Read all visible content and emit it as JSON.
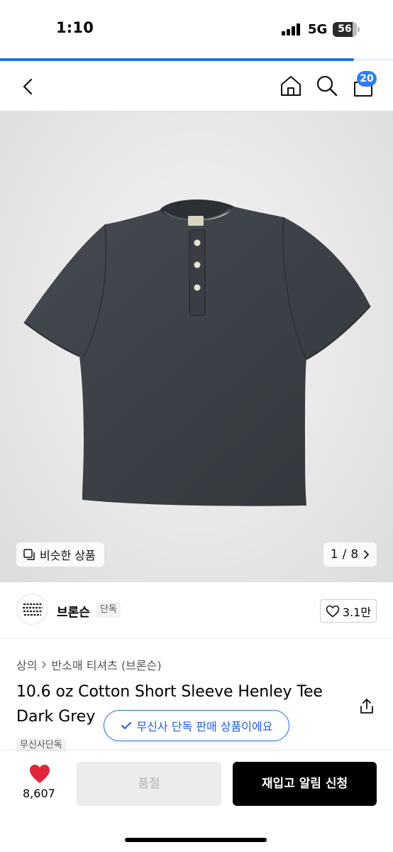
{
  "status_bar": {
    "time": "1:10",
    "network": "5G",
    "battery": "56"
  },
  "page_progress": 0.9,
  "nav": {
    "cart_count": "20"
  },
  "gallery": {
    "similar_label": "비슷한 상품",
    "current": "1",
    "separator": "/",
    "total": "8",
    "next_icon": "chevron-right-icon"
  },
  "brand": {
    "name": "브론슨",
    "tag": "단독",
    "likes": "3.1만",
    "logo_text": "BRONSON MFG. CO."
  },
  "breadcrumb": [
    "상의",
    "반소매 티셔츠 (브론슨)"
  ],
  "product": {
    "title_line1": "10.6 oz Cotton Short Sleeve Henley Tee",
    "title_line2": "Dark Grey",
    "exclusive_banner": "무신사 단독 판매 상품이에요",
    "exclusive_tag": "무신사단독"
  },
  "bottom_bar": {
    "like_count": "8,607",
    "soldout_label": "품절",
    "restock_label": "재입고 알림 신청"
  },
  "colors": {
    "accent": "#1e73e8",
    "pill_blue": "#2f6ee8",
    "heart_red": "#e0263a",
    "shirt": "#3b3f45"
  }
}
